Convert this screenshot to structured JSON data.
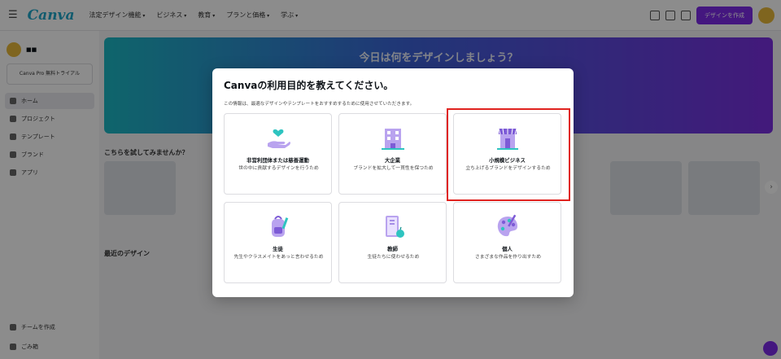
{
  "app": {
    "logo": "Canva",
    "nav": [
      "法定デザイン機能",
      "ビジネス",
      "教育",
      "プランと価格",
      "学ぶ"
    ],
    "create_button": "デザインを作成"
  },
  "sidebar": {
    "user_name": "■■",
    "pro_label": "Canva Pro 無料トライアル",
    "items": [
      "ホーム",
      "プロジェクト",
      "テンプレート",
      "ブランド",
      "アプリ"
    ],
    "bottom_items": [
      "チームを作成",
      "ごみ箱"
    ]
  },
  "banner": {
    "title": "今日は何をデザインしましょう？"
  },
  "sections": {
    "suggest": "こちらを試してみませんか？",
    "recent": "最近のデザイン"
  },
  "modal": {
    "title": "Canvaの利用目的を教えてください。",
    "subtitle": "この情報は、最適なデザインやテンプレートをおすすめするために使用させていただきます。",
    "options": [
      {
        "title": "非営利団体または慈善運動",
        "desc": "世の中に貢献するデザインを行うため",
        "icon": "heart-hand-icon"
      },
      {
        "title": "大企業",
        "desc": "ブランドを拡大して一貫性を保つため",
        "icon": "office-building-icon"
      },
      {
        "title": "小規模ビジネス",
        "desc": "立ち上げるブランドをデザインするため",
        "icon": "storefront-icon"
      },
      {
        "title": "生徒",
        "desc": "先生やクラスメイトをあっと言わせるため",
        "icon": "backpack-icon"
      },
      {
        "title": "教師",
        "desc": "生徒たちに使わせるため",
        "icon": "book-apple-icon"
      },
      {
        "title": "個人",
        "desc": "さまざまな作品を作り出すため",
        "icon": "palette-icon"
      }
    ]
  },
  "colors": {
    "accent": "#7d2ae8",
    "highlight": "#e0231f"
  }
}
